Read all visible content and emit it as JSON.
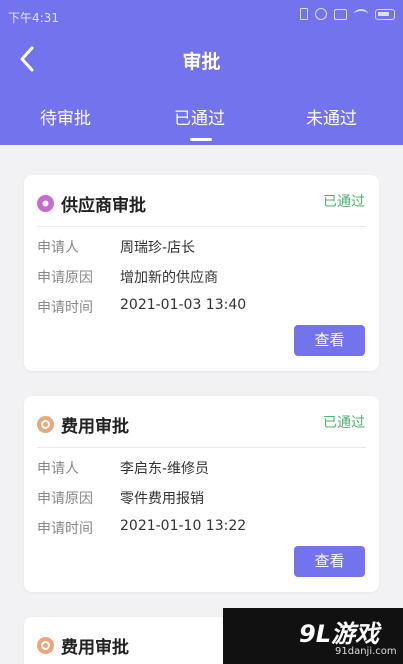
{
  "statusbar": {
    "time": "下午4:31"
  },
  "header": {
    "title": "审批"
  },
  "tabs": [
    {
      "label": "待审批"
    },
    {
      "label": "已通过"
    },
    {
      "label": "未通过"
    }
  ],
  "cards": [
    {
      "title": "供应商审批",
      "status": "已通过",
      "rows": [
        {
          "label": "申请人",
          "value": "周瑞珍-店长"
        },
        {
          "label": "申请原因",
          "value": "增加新的供应商"
        },
        {
          "label": "申请时间",
          "value": "2021-01-03 13:40"
        }
      ],
      "button": "查看"
    },
    {
      "title": "费用审批",
      "status": "已通过",
      "rows": [
        {
          "label": "申请人",
          "value": "李启东-维修员"
        },
        {
          "label": "申请原因",
          "value": "零件费用报销"
        },
        {
          "label": "申请时间",
          "value": "2021-01-10 13:22"
        }
      ],
      "button": "查看"
    },
    {
      "title": "费用审批"
    }
  ],
  "watermark": {
    "logo": "9L游戏",
    "url": "91danji.com"
  },
  "colors": {
    "primary": "#7373ee",
    "approved": "#4bb56e",
    "background": "#f2f2f4"
  }
}
